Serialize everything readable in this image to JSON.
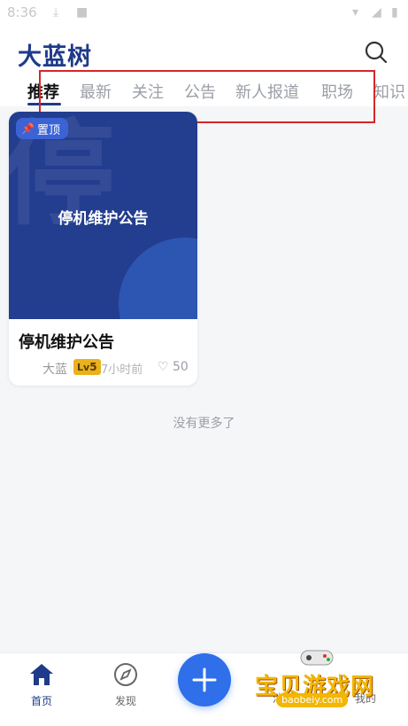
{
  "status_bar": {
    "time": "8:36"
  },
  "header": {
    "app_title": "大蓝树"
  },
  "tabs": [
    "推荐",
    "最新",
    "关注",
    "公告",
    "新人报道",
    "职场",
    "知识"
  ],
  "active_tab": "推荐",
  "card": {
    "cover_text": "停机维护公告",
    "cover_bg_char": "停",
    "pin_label": "置顶",
    "title": "停机维护公告",
    "author": "大蓝",
    "level_prefix": "Lv",
    "level_num": "5",
    "time": "7小时前",
    "likes": "50"
  },
  "feed_end_text": "没有更多了",
  "bottom_nav": {
    "home": "首页",
    "discover": "发现",
    "messages": "消息",
    "mine": "我的"
  },
  "watermark": {
    "text": "宝贝游戏网",
    "url": "baobeiy.com"
  },
  "colors": {
    "brand": "#1f3a8a",
    "fab": "#2f6fea",
    "annotation_box": "#d6252b"
  },
  "icons": [
    "search-icon",
    "home-icon",
    "compass-icon",
    "plus-icon",
    "pin-icon",
    "heart-icon"
  ]
}
